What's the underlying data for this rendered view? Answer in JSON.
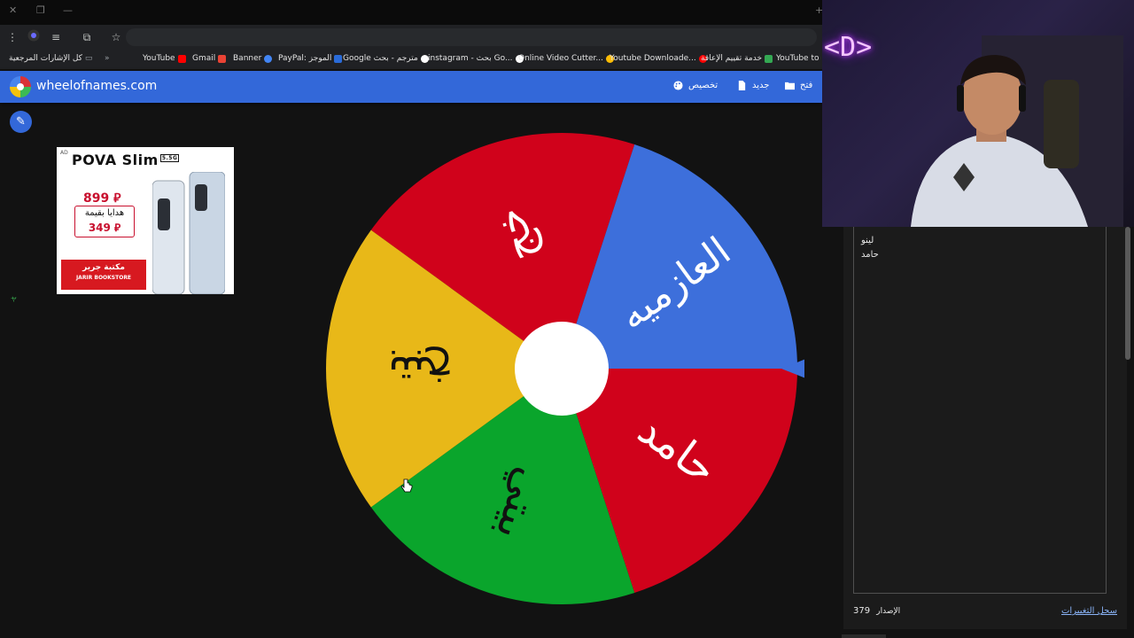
{
  "browser": {
    "bookmarks_folder": "كل الإشارات المرجعية",
    "bookmarks": [
      {
        "label": "YouTube",
        "color": "#ff0000"
      },
      {
        "label": "Gmail",
        "color": "#ea4335"
      },
      {
        "label": "Banner",
        "color": "#4285f4"
      },
      {
        "label": "PayPal: الموجز",
        "color": "#2a6bd8"
      },
      {
        "label": "Google مترجم - بحث",
        "color": "#4285f4"
      },
      {
        "label": "instagram - بحث Go...",
        "color": "#9aa0a6"
      },
      {
        "label": "Online Video Cutter...",
        "color": "#fbbc04"
      },
      {
        "label": "Youtube Downloade...",
        "color": "#ff0000"
      },
      {
        "label": "خدمة تقييم الإعاقة",
        "color": "#34a853"
      },
      {
        "label": "YouTube to Mp",
        "color": "#ff0000"
      }
    ]
  },
  "app": {
    "site_title": "wheelofnames.com",
    "menu": {
      "customize": "تخصيص",
      "new": "جديد",
      "open": "فتح"
    },
    "accent_color": "#3368d9"
  },
  "ad": {
    "tag": "AD",
    "brand": "POVA Slim",
    "brand_badge": "5.5G",
    "price": "899 ⃁",
    "gift_line": "هدايا بقيمة",
    "gift_value": "349 ⃁",
    "store_arabic": "مكتبة جرير",
    "store_english": "JARIR BOOKSTORE"
  },
  "wheel": {
    "segments": [
      {
        "label": "خج",
        "color": "#d0021b"
      },
      {
        "label": "العازميه",
        "color": "#3d6fdb"
      },
      {
        "label": "حامد",
        "color": "#d0021b"
      },
      {
        "label": "بيتي",
        "color": "#0aa52c"
      },
      {
        "label": "بتبخ",
        "color": "#e8b818"
      }
    ],
    "center_color": "#ffffff",
    "pointer_color": "#3d6fdb"
  },
  "webcam": {
    "neon_sign": "<D>"
  },
  "entries_panel": {
    "entries": [
      "لينو",
      "حامد"
    ],
    "version_label": "الإصدار",
    "version_number": "379",
    "changelog_link": "سجل التغييرات"
  },
  "stray_glyph": "ヤ"
}
